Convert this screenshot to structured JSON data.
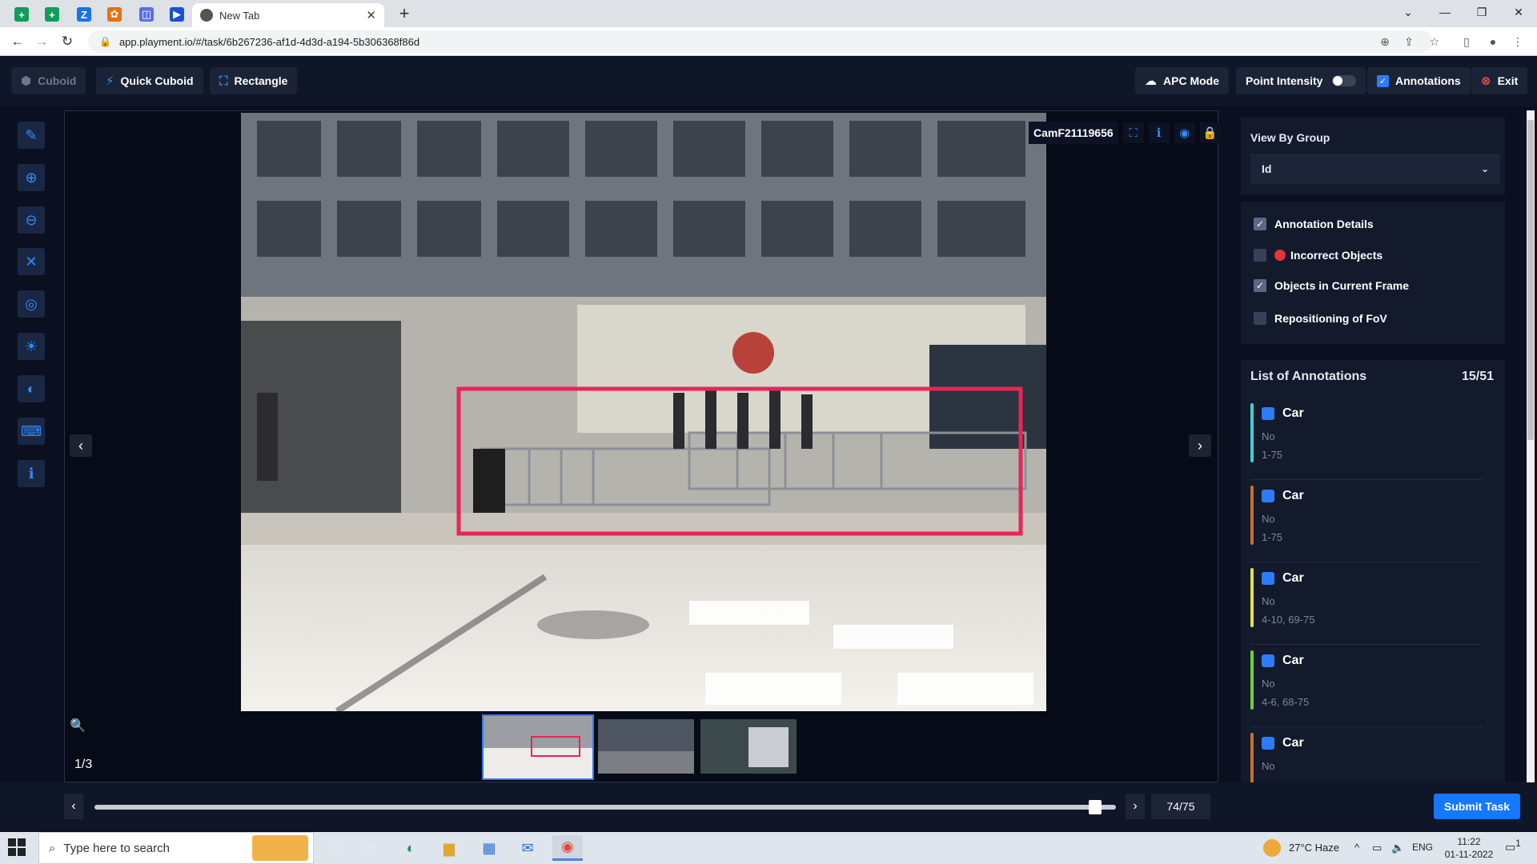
{
  "browser": {
    "tab_title": "New Tab",
    "url": "app.playment.io/#/task/6b267236-af1d-4d3d-a194-5b306368f86d",
    "pinned_tabs": [
      {
        "icon": "sheets-icon",
        "color": "#0f9d58",
        "glyph": "+"
      },
      {
        "icon": "sheets-icon",
        "color": "#0f9d58",
        "glyph": "+"
      },
      {
        "icon": "zoho-icon",
        "color": "#1a73e8",
        "glyph": "Z"
      },
      {
        "icon": "colorful-app-icon",
        "color": "#e8710a",
        "glyph": "✿"
      },
      {
        "icon": "meet-icon",
        "color": "#5b6ee1",
        "glyph": "◫"
      },
      {
        "icon": "playment-icon",
        "color": "#1a4fd6",
        "glyph": "▶"
      }
    ]
  },
  "toolbar": {
    "cuboid": "Cuboid",
    "quick_cuboid": "Quick Cuboid",
    "rectangle": "Rectangle",
    "apc_mode": "APC Mode",
    "point_intensity": "Point Intensity",
    "annotations": "Annotations",
    "exit": "Exit"
  },
  "viewer": {
    "camera_label": "CamF21119656",
    "image_counter": "1/3"
  },
  "panel": {
    "view_by_group_label": "View By Group",
    "group_value": "Id",
    "filters": [
      {
        "label": "Annotation Details",
        "checked": true
      },
      {
        "label": "Incorrect Objects",
        "checked": false
      },
      {
        "label": "Objects in Current Frame",
        "checked": true
      },
      {
        "label": "Repositioning of FoV",
        "checked": false
      }
    ],
    "list_title": "List of Annotations",
    "list_count": "15/51",
    "annotations": [
      {
        "type": "Car",
        "sub": "No",
        "frames": "1-75",
        "color": "#3ad1d6"
      },
      {
        "type": "Car",
        "sub": "No",
        "frames": "1-75",
        "color": "#c8702a"
      },
      {
        "type": "Car",
        "sub": "No",
        "frames": "4-10, 69-75",
        "color": "#e8e04a"
      },
      {
        "type": "Car",
        "sub": "No",
        "frames": "4-6, 68-75",
        "color": "#6ccf3a"
      },
      {
        "type": "Car",
        "sub": "No",
        "frames": "",
        "color": "#c8702a"
      }
    ]
  },
  "timeline": {
    "frame_counter": "74/75",
    "current_frame": 74,
    "total_frames": 75,
    "submit": "Submit Task"
  },
  "taskbar": {
    "search_placeholder": "Type here to search",
    "weather": "27°C  Haze",
    "language": "ENG",
    "time": "11:22",
    "date": "01-11-2022",
    "notification_count": "1"
  }
}
